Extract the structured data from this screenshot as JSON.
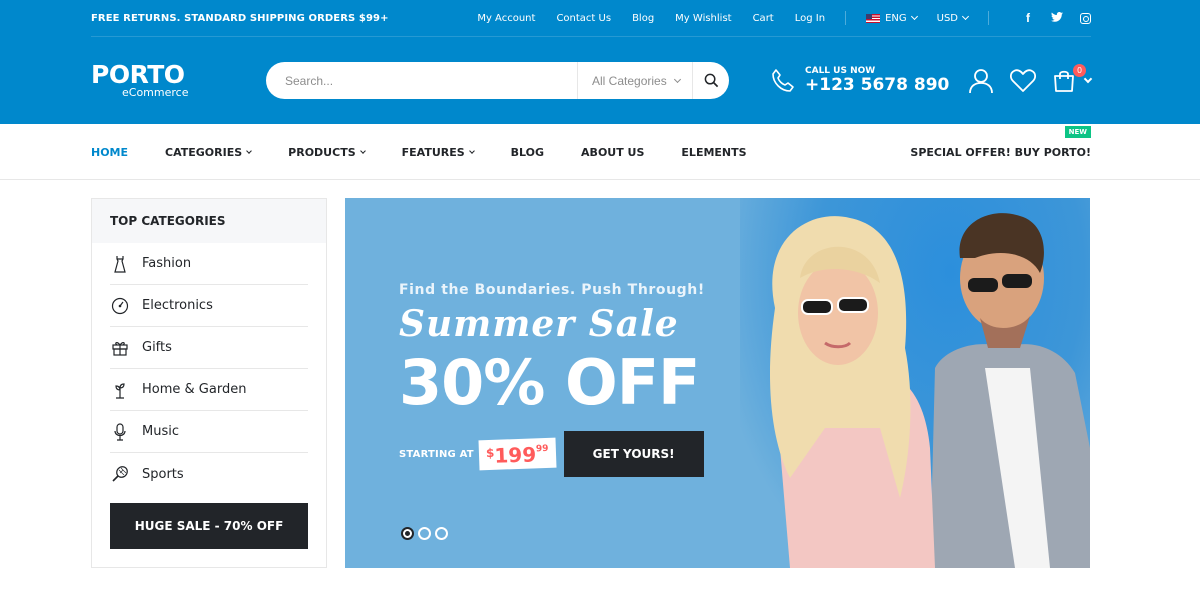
{
  "topbar": {
    "promo": "FREE RETURNS. STANDARD SHIPPING ORDERS $99+",
    "links": [
      "My Account",
      "Contact Us",
      "Blog",
      "My Wishlist",
      "Cart",
      "Log In"
    ],
    "language": "ENG",
    "currency": "USD",
    "social": [
      "facebook-icon",
      "twitter-icon",
      "instagram-icon"
    ]
  },
  "header": {
    "logo_main": "PORTO",
    "logo_sub": "eCommerce",
    "search_placeholder": "Search...",
    "category_select": "All Categories",
    "call_label": "CALL US NOW",
    "phone": "+123 5678 890",
    "cart_count": "0"
  },
  "nav": {
    "items": [
      "HOME",
      "CATEGORIES",
      "PRODUCTS",
      "FEATURES",
      "BLOG",
      "ABOUT US",
      "ELEMENTS"
    ],
    "special": "SPECIAL OFFER! BUY PORTO!",
    "new_badge": "NEW"
  },
  "sidebar": {
    "title": "TOP CATEGORIES",
    "categories": [
      "Fashion",
      "Electronics",
      "Gifts",
      "Home & Garden",
      "Music",
      "Sports"
    ],
    "cta": "HUGE SALE - 70% OFF"
  },
  "slider": {
    "tagline": "Find the Boundaries. Push Through!",
    "title": "Summer Sale",
    "discount": "30% OFF",
    "starting_label": "STARTING AT",
    "price_currency": "$",
    "price_main": "199",
    "price_cents": "99",
    "cta": "GET YOURS!",
    "active_slide": 1,
    "total_slides": 3
  },
  "colors": {
    "brand": "#0088cc",
    "dark": "#222529",
    "accent_red": "#ff5b5b",
    "new_green": "#0cc485",
    "banner_bg": "#6fb1dd"
  }
}
